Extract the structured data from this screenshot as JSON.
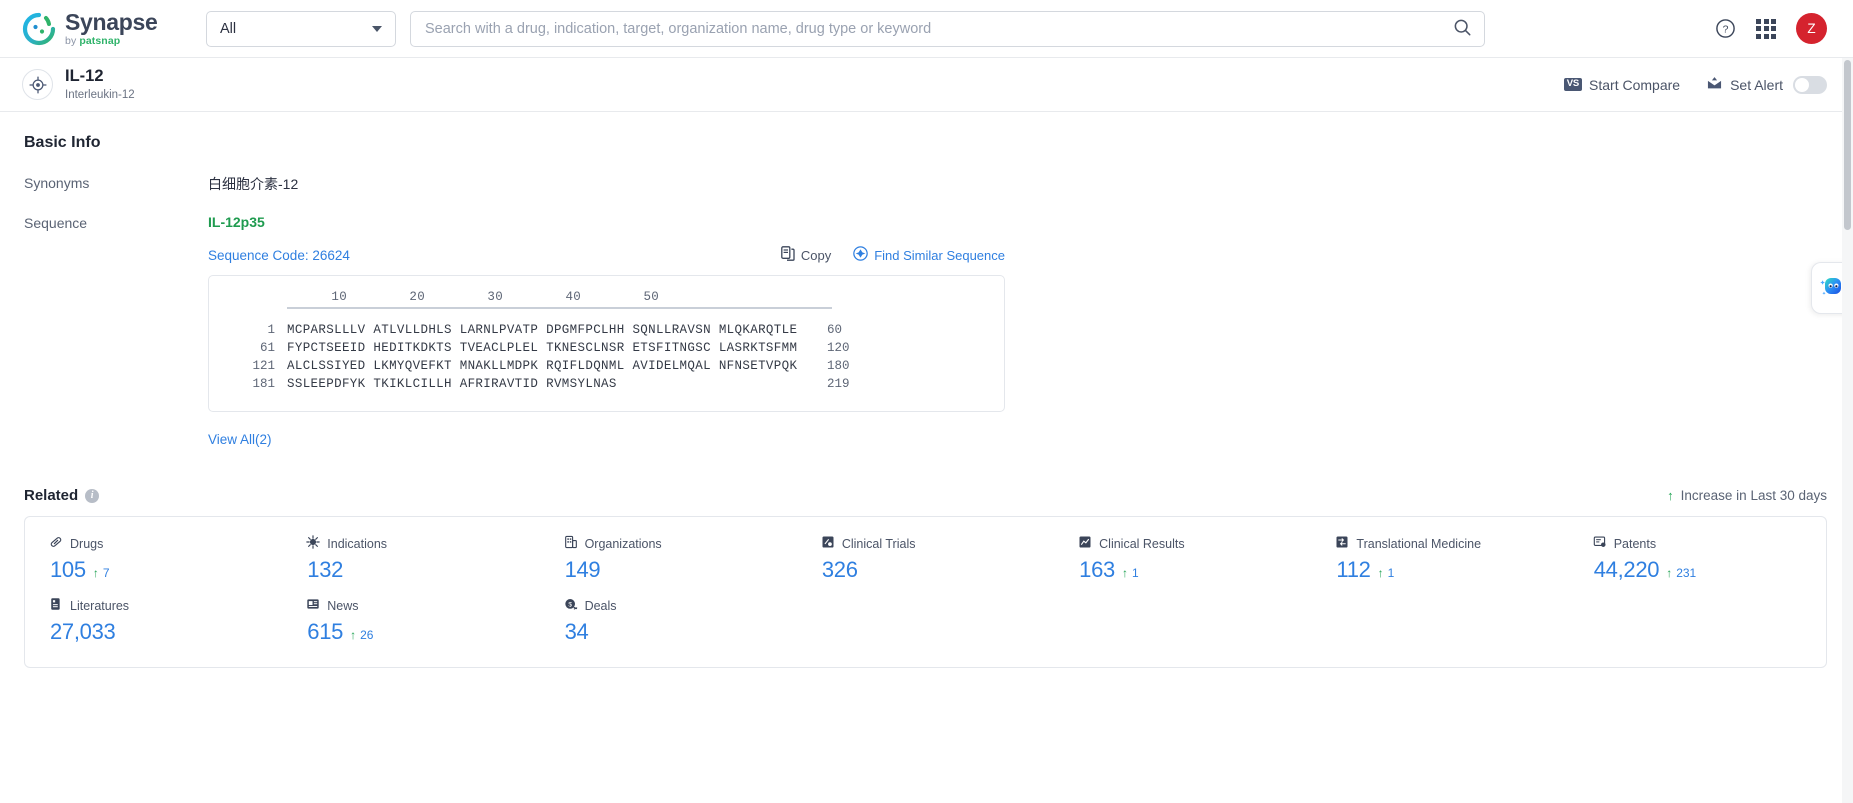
{
  "topbar": {
    "brand": {
      "name": "Synapse",
      "by": "by ",
      "patsnap": "patsnap"
    },
    "category_select": {
      "value": "All"
    },
    "search": {
      "value": "",
      "placeholder": "Search with a drug, indication, target, organization name, drug type or keyword"
    },
    "help_icon": "help-circle-icon",
    "apps_icon": "apps-grid-icon",
    "avatar_initial": "Z"
  },
  "entity": {
    "icon": "target-icon",
    "name": "IL-12",
    "alias": "Interleukin-12",
    "start_compare": "Start Compare",
    "vs_badge": "VS",
    "set_alert": "Set Alert",
    "alert_enabled": false
  },
  "basic_info": {
    "title": "Basic Info",
    "synonyms_label": "Synonyms",
    "synonyms_value": "白细胞介素-12",
    "sequence_label": "Sequence",
    "sequence_name": "IL-12p35",
    "sequence_code": "Sequence Code: 26624",
    "copy_label": "Copy",
    "find_similar_label": "Find Similar Sequence",
    "view_all": "View All(2)",
    "ruler": "        10        20        30        40        50",
    "lines": [
      {
        "start": "1",
        "residues": "MCPARSLLLV ATLVLLDHLS LARNLPVATP DPGMFPCLHH SQNLLRAVSN MLQKARQTLE",
        "end": "60"
      },
      {
        "start": "61",
        "residues": "FYPCTSEEID HEDITKDKTS TVEACLPLEL TKNESCLNSR ETSFITNGSC LASRKTSFMM",
        "end": "120"
      },
      {
        "start": "121",
        "residues": "ALCLSSIYED LKMYQVEFKT MNAKLLMDPK RQIFLDQNML AVIDELMQAL NFNSETVPQK",
        "end": "180"
      },
      {
        "start": "181",
        "residues": "SSLEEPDFYK TKIKLCILLH AFRIRAVTID RVMSYLNAS",
        "end": "219"
      }
    ]
  },
  "related": {
    "title": "Related",
    "info_icon": "info-icon",
    "legend": "Increase in Last 30 days",
    "metrics": [
      {
        "icon": "pill-icon",
        "label": "Drugs",
        "value": "105",
        "delta": "7"
      },
      {
        "icon": "virus-icon",
        "label": "Indications",
        "value": "132",
        "delta": ""
      },
      {
        "icon": "building-icon",
        "label": "Organizations",
        "value": "149",
        "delta": ""
      },
      {
        "icon": "clipboard-icon",
        "label": "Clinical Trials",
        "value": "326",
        "delta": ""
      },
      {
        "icon": "chart-doc-icon",
        "label": "Clinical Results",
        "value": "163",
        "delta": "1"
      },
      {
        "icon": "transfer-icon",
        "label": "Translational Medicine",
        "value": "112",
        "delta": "1"
      },
      {
        "icon": "patent-icon",
        "label": "Patents",
        "value": "44,220",
        "delta": "231"
      },
      {
        "icon": "book-icon",
        "label": "Literatures",
        "value": "27,033",
        "delta": ""
      },
      {
        "icon": "news-icon",
        "label": "News",
        "value": "615",
        "delta": "26"
      },
      {
        "icon": "deal-icon",
        "label": "Deals",
        "value": "34",
        "delta": ""
      }
    ]
  },
  "assistant": {
    "icon": "ai-assistant-icon"
  },
  "colors": {
    "accent_blue": "#2f7fe0",
    "green": "#23a455",
    "sequence_green": "#1f9b4f",
    "avatar_red": "#d5232e",
    "text_dark": "#1f2532"
  }
}
